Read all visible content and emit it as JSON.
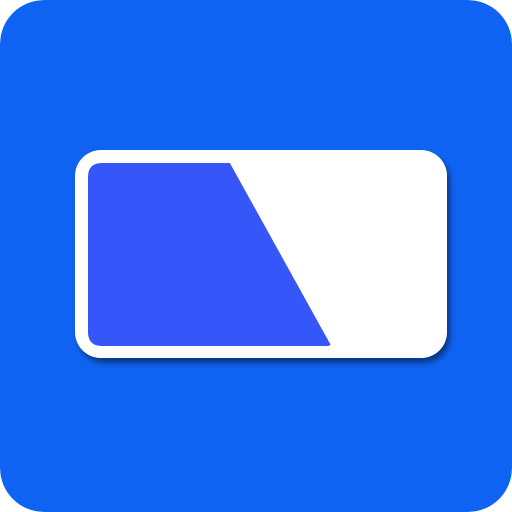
{
  "icon": {
    "name": "app-icon",
    "glyph": "progress-bar-icon",
    "colors": {
      "background": "#0f63f2",
      "panel": "#ffffff",
      "fill": "#3557fa",
      "shadow": "#0a3f9c"
    },
    "fill_fraction": 0.55
  }
}
